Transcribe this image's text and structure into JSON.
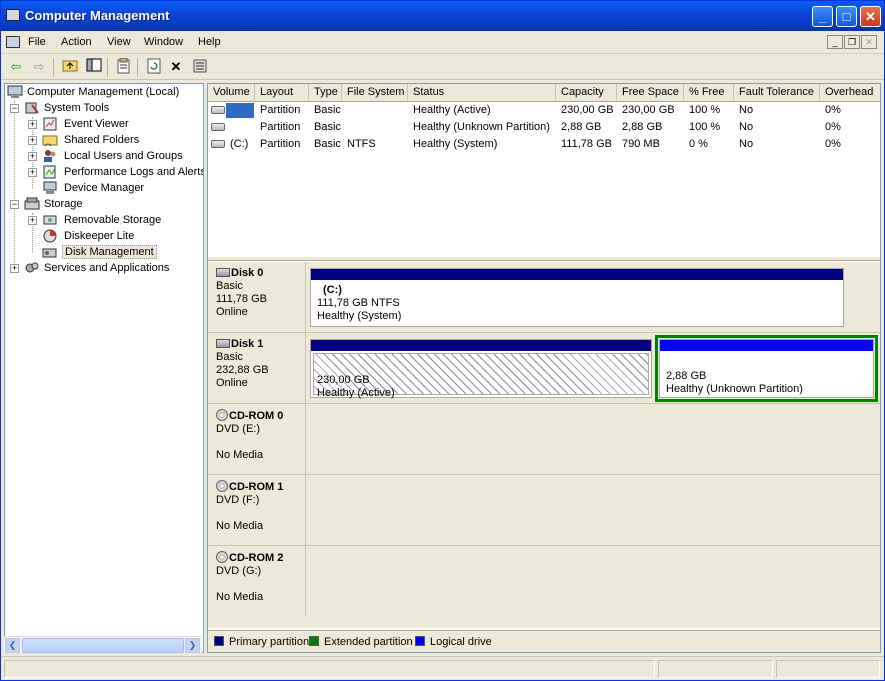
{
  "window": {
    "title": "Computer Management",
    "min_glyph": "_",
    "max_glyph": "□",
    "close_glyph": "✕"
  },
  "menu": [
    "File",
    "Action",
    "View",
    "Window",
    "Help"
  ],
  "toolbar_icons": [
    "back-arrow-icon",
    "forward-arrow-icon",
    "up-folder-icon",
    "show-hide-tree-icon",
    "properties-icon",
    "refresh-icon",
    "delete-icon",
    "export-list-icon"
  ],
  "tree": {
    "root": "Computer Management (Local)",
    "system_tools": "System Tools",
    "event_viewer": "Event Viewer",
    "shared_folders": "Shared Folders",
    "local_users": "Local Users and Groups",
    "perf_logs": "Performance Logs and Alerts",
    "device_manager": "Device Manager",
    "storage": "Storage",
    "removable_storage": "Removable Storage",
    "diskeeper": "Diskeeper Lite",
    "disk_management": "Disk Management",
    "services_apps": "Services and Applications"
  },
  "volume_list": {
    "columns": [
      "Volume",
      "Layout",
      "Type",
      "File System",
      "Status",
      "Capacity",
      "Free Space",
      "% Free",
      "Fault Tolerance",
      "Overhead"
    ],
    "rows": [
      [
        "",
        "Partition",
        "Basic",
        "",
        "Healthy (Active)",
        "230,00 GB",
        "230,00 GB",
        "100 %",
        "No",
        "0%"
      ],
      [
        "",
        "Partition",
        "Basic",
        "",
        "Healthy (Unknown Partition)",
        "2,88 GB",
        "2,88 GB",
        "100 %",
        "No",
        "0%"
      ],
      [
        "(C:)",
        "Partition",
        "Basic",
        "NTFS",
        "Healthy (System)",
        "111,78 GB",
        "790 MB",
        "0 %",
        "No",
        "0%"
      ]
    ]
  },
  "disks": [
    {
      "name": "Disk 0",
      "type": "Basic",
      "size": "111,78 GB",
      "state": "Online",
      "partitions": [
        {
          "label": "(C:)",
          "line1": "111,78 GB NTFS",
          "line2": "Healthy (System)",
          "kind": "primary"
        }
      ]
    },
    {
      "name": "Disk 1",
      "type": "Basic",
      "size": "232,88 GB",
      "state": "Online",
      "partitions": [
        {
          "label": "",
          "line1": "230,00 GB",
          "line2": "Healthy (Active)",
          "kind": "primary"
        },
        {
          "label": "",
          "line1": "2,88 GB",
          "line2": "Healthy (Unknown Partition)",
          "kind": "logical"
        }
      ]
    }
  ],
  "cdroms": [
    {
      "name": "CD-ROM 0",
      "drive": "DVD (E:)",
      "media": "No Media"
    },
    {
      "name": "CD-ROM 1",
      "drive": "DVD (F:)",
      "media": "No Media"
    },
    {
      "name": "CD-ROM 2",
      "drive": "DVD (G:)",
      "media": "No Media"
    }
  ],
  "legend": [
    {
      "label": "Primary partition",
      "color": "#000080"
    },
    {
      "label": "Extended partition",
      "color": "#008000"
    },
    {
      "label": "Logical drive",
      "color": "#0000ff"
    }
  ],
  "colors": {
    "primary_bar": "#000080",
    "logical_bar": "#0000ff",
    "extended_border": "#008000"
  }
}
